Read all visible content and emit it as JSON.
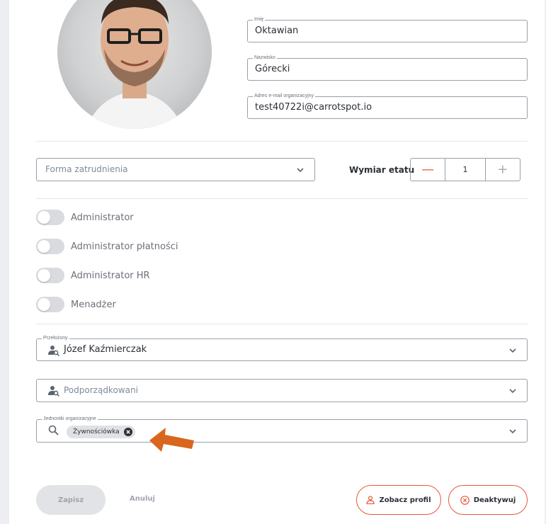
{
  "form": {
    "first_name": {
      "label": "Imię",
      "value": "Oktawian"
    },
    "last_name": {
      "label": "Nazwisko",
      "value": "Górecki"
    },
    "email": {
      "label": "Adres e-mail organizacyjny",
      "value": "test40722i@carrotspot.io"
    },
    "employment_type": {
      "placeholder": "Forma zatrudnienia"
    },
    "work_time": {
      "label": "Wymiar etatu",
      "value": "1",
      "minus": "—",
      "plus": "+"
    }
  },
  "roles": [
    {
      "label": "Administrator",
      "enabled": false
    },
    {
      "label": "Administrator płatności",
      "enabled": false
    },
    {
      "label": "Administrator HR",
      "enabled": false
    },
    {
      "label": "Menadżer",
      "enabled": false
    }
  ],
  "supervisor": {
    "label": "Przełożony",
    "value": "Józef Kaźmierczak"
  },
  "subordinates": {
    "placeholder": "Podporządkowani"
  },
  "org_units": {
    "label": "Jednostki organizacyjne",
    "chips": [
      "Żywnościówka"
    ]
  },
  "actions": {
    "save": "Zapisz",
    "cancel": "Anuluj",
    "view_profile": "Zobacz profil",
    "deactivate": "Deaktywuj"
  },
  "colors": {
    "accent": "#e8573a",
    "arrow": "#d9661f",
    "border": "#9aa0a8",
    "toggle_off": "#d9dbde"
  },
  "icons": [
    "chevron-down-icon",
    "person-search-icon",
    "search-icon",
    "close-circle-icon",
    "user-icon",
    "cancel-circle-icon",
    "arrow-annotation-icon"
  ]
}
